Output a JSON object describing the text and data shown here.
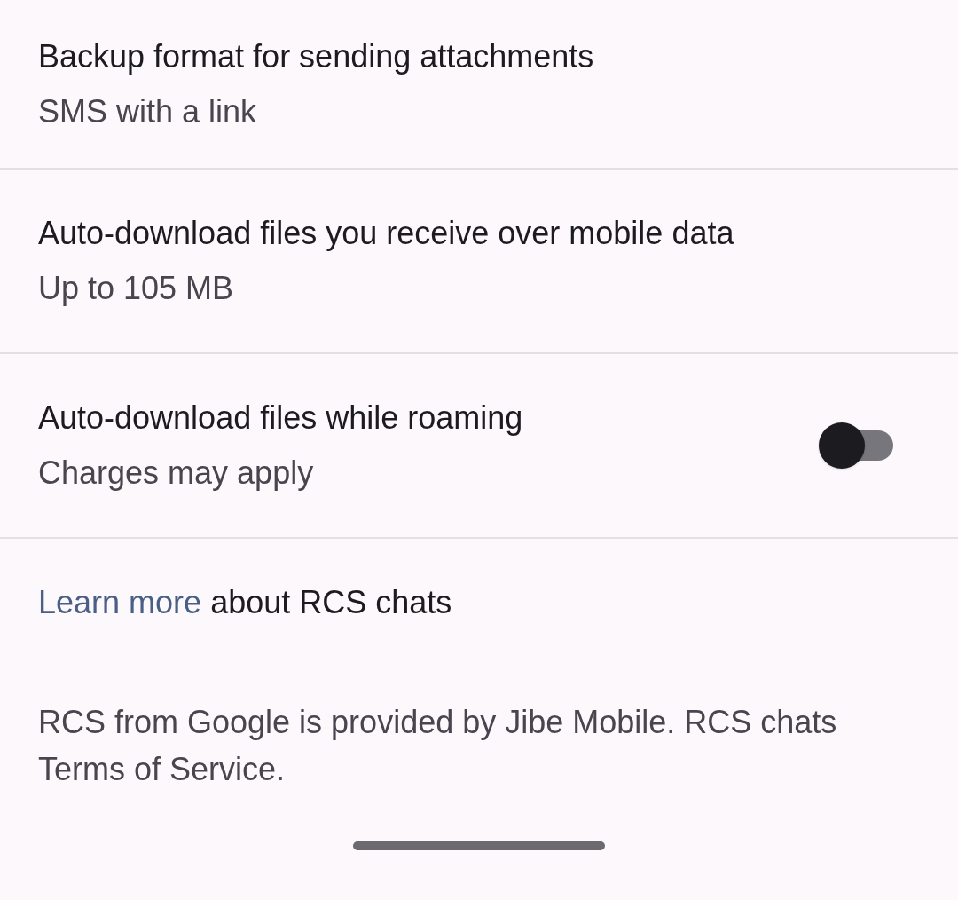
{
  "settings": [
    {
      "kind": "value",
      "title": "Backup format for sending attachments",
      "subtitle": "SMS with a link"
    },
    {
      "kind": "value",
      "title": "Auto-download files you receive over mobile data",
      "subtitle": "Up to 105 MB"
    },
    {
      "kind": "toggle",
      "title": "Auto-download files while roaming",
      "subtitle": "Charges may apply",
      "on": false
    }
  ],
  "learn_more": {
    "link": "Learn more",
    "text": "about RCS chats"
  },
  "footer": "RCS from Google is provided by Jibe Mobile. RCS chats Terms of Service."
}
